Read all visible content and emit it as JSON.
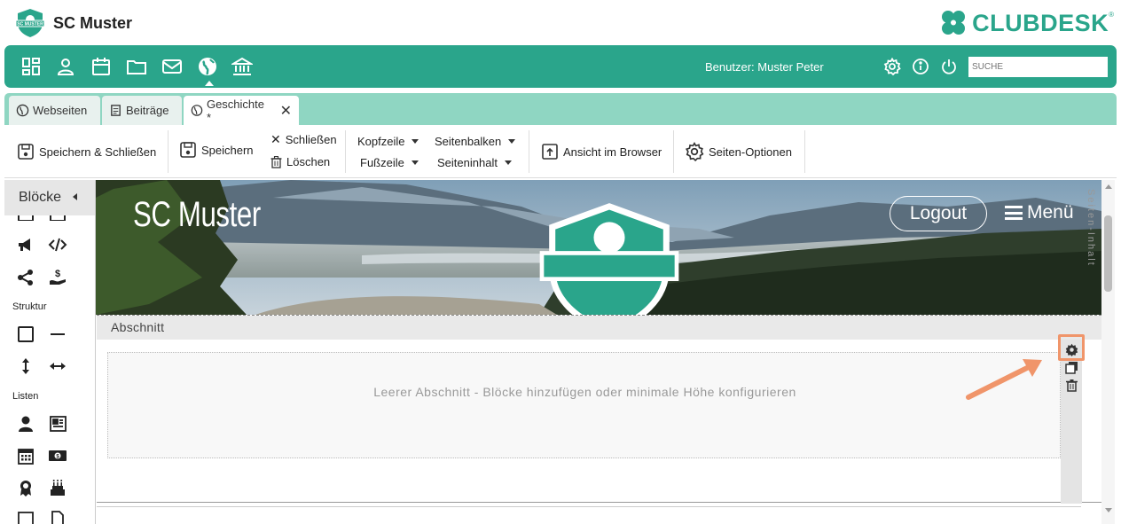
{
  "header": {
    "app_name": "SC Muster",
    "brand_logo": "CLUBDESK",
    "brand_reg": "®",
    "badge_text": "SC MUSTER",
    "accent_color": "#2aa58b"
  },
  "nav": {
    "icons": [
      "dashboard-icon",
      "person-icon",
      "calendar-icon",
      "folder-icon",
      "mail-icon",
      "globe-icon",
      "bank-icon"
    ],
    "active": "globe-icon",
    "user_label": "Benutzer: Muster Peter",
    "tools": [
      "settings-icon",
      "info-icon",
      "power-icon"
    ],
    "search_placeholder": "SUCHE"
  },
  "tabs": [
    {
      "label": "Webseiten",
      "icon": "globe-icon"
    },
    {
      "label": "Beiträge",
      "icon": "document-icon"
    },
    {
      "label": "Geschichte *",
      "icon": "globe-icon",
      "active": true,
      "closable": true
    }
  ],
  "toolbar": {
    "save_close": "Speichern & Schließen",
    "save": "Speichern",
    "close": "Schließen",
    "delete": "Löschen",
    "header": "Kopfzeile",
    "footer": "Fußzeile",
    "sidebar": "Seitenbalken",
    "page_content": "Seiteninhalt",
    "view_browser": "Ansicht im Browser",
    "page_options": "Seiten-Optionen"
  },
  "sidebar": {
    "title": "Blöcke",
    "group_structure": "Struktur",
    "group_lists": "Listen"
  },
  "preview": {
    "site_title": "SC Muster",
    "logout": "Logout",
    "menu": "Menü",
    "section_title": "Abschnitt",
    "empty_text": "Leerer Abschnitt - Blöcke hinzufügen oder minimale Höhe konfigurieren",
    "side_label": "Seiten-Inhalt",
    "highlight_color": "#f0956a"
  }
}
